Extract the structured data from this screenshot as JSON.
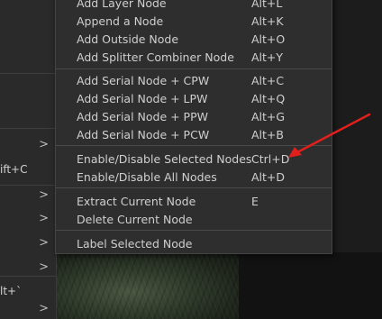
{
  "left_menu": {
    "items": [
      {
        "fragment": "",
        "has_submenu": true
      },
      {
        "fragment": "ift+C",
        "has_submenu": false
      },
      {
        "fragment": "",
        "has_submenu": true
      },
      {
        "fragment": "",
        "has_submenu": true
      },
      {
        "fragment": "",
        "has_submenu": true
      },
      {
        "fragment": "",
        "has_submenu": true
      },
      {
        "fragment": "lt+`",
        "has_submenu": false
      },
      {
        "fragment": "",
        "has_submenu": true
      }
    ],
    "chevron": ">"
  },
  "submenu": {
    "groups": [
      [
        {
          "label": "Add Layer Node",
          "shortcut": "Alt+L"
        },
        {
          "label": "Append a Node",
          "shortcut": "Alt+K"
        },
        {
          "label": "Add Outside Node",
          "shortcut": "Alt+O"
        },
        {
          "label": "Add Splitter Combiner Node",
          "shortcut": "Alt+Y"
        }
      ],
      [
        {
          "label": "Add Serial Node + CPW",
          "shortcut": "Alt+C"
        },
        {
          "label": "Add Serial Node + LPW",
          "shortcut": "Alt+Q"
        },
        {
          "label": "Add Serial Node + PPW",
          "shortcut": "Alt+G"
        },
        {
          "label": "Add Serial Node + PCW",
          "shortcut": "Alt+B"
        }
      ],
      [
        {
          "label": "Enable/Disable Selected Nodes",
          "shortcut": "Ctrl+D"
        },
        {
          "label": "Enable/Disable All Nodes",
          "shortcut": "Alt+D"
        }
      ],
      [
        {
          "label": "Extract Current Node",
          "shortcut": "E"
        },
        {
          "label": "Delete Current Node",
          "shortcut": ""
        }
      ],
      [
        {
          "label": "Label Selected Node",
          "shortcut": ""
        }
      ]
    ]
  },
  "annotation": {
    "color": "#e0201c",
    "icon": "red-arrow-icon",
    "points_to": "Enable/Disable Selected Nodes"
  },
  "colors": {
    "menu_bg": "#2e2e2e",
    "text": "#cfcfcf",
    "separator": "#4a4a4a"
  }
}
